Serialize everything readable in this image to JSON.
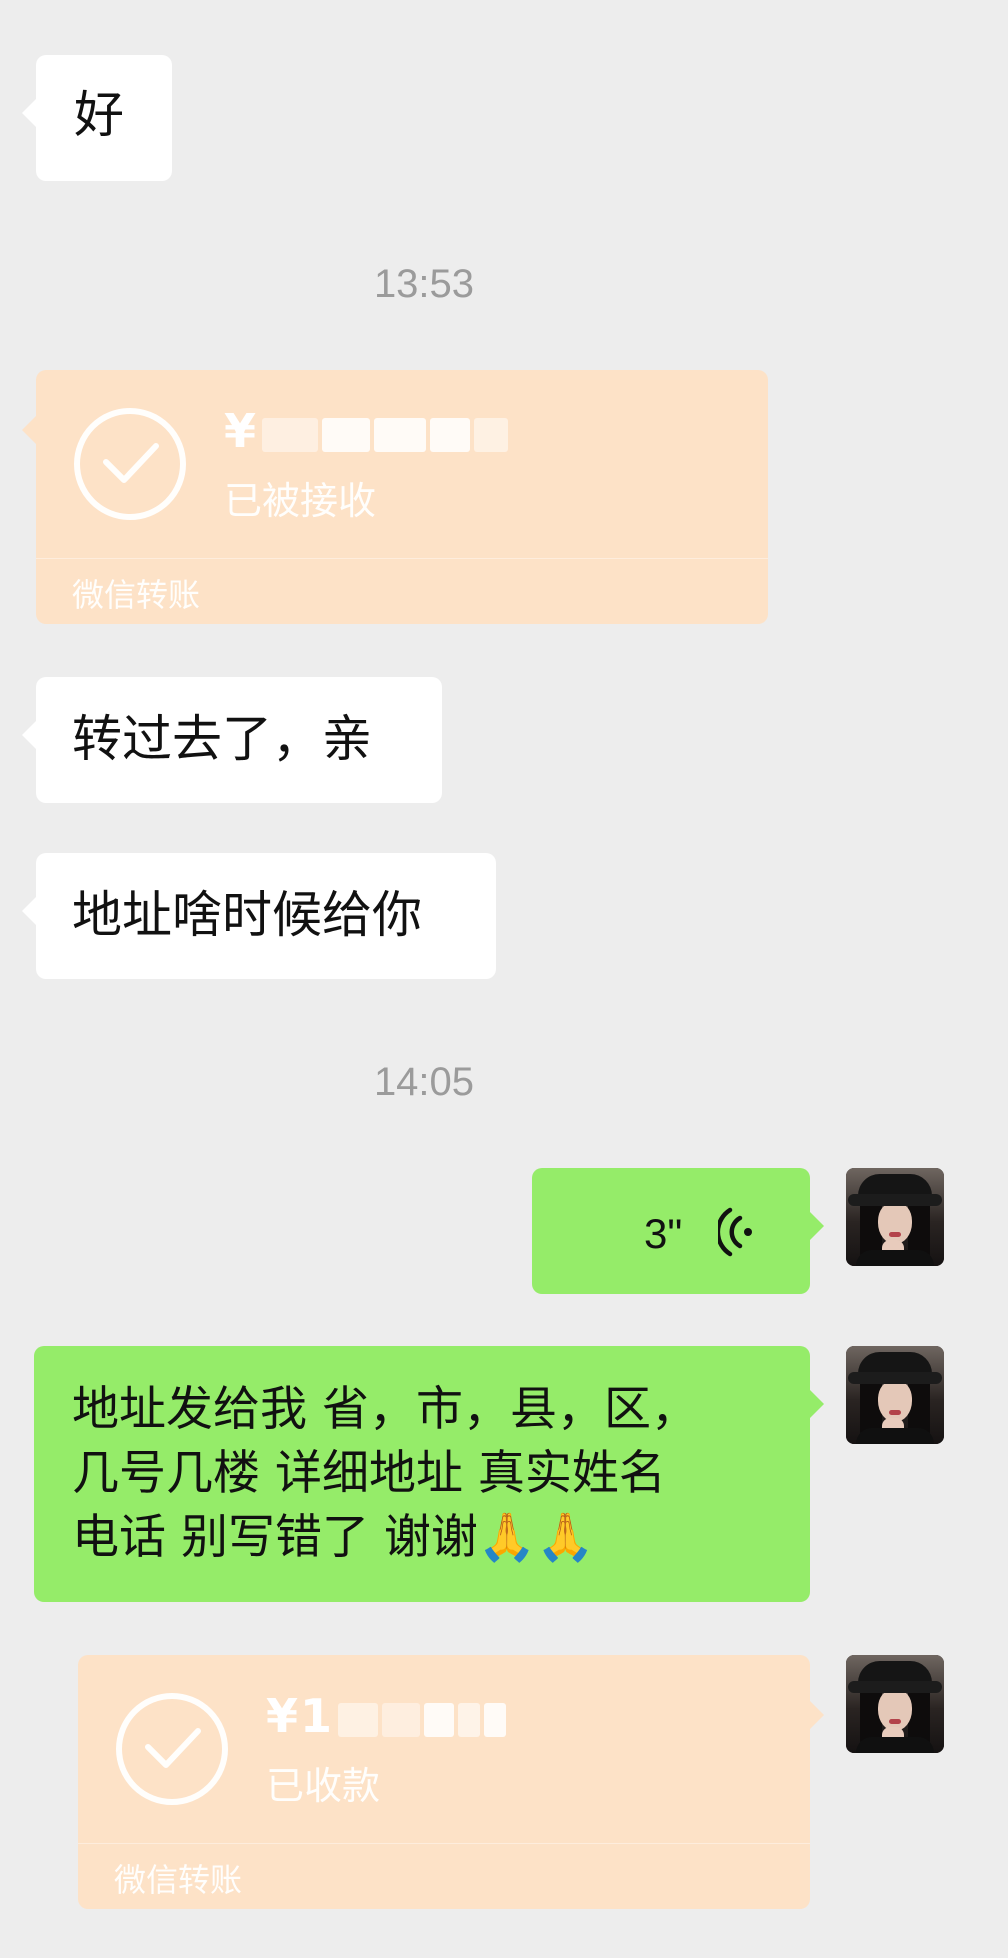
{
  "messages": {
    "m1": {
      "text": "好"
    },
    "t1": {
      "time": "13:53"
    },
    "transfer1": {
      "amount_visible": "¥",
      "status": "已被接收",
      "footer": "微信转账"
    },
    "m2": {
      "text": "转过去了，亲"
    },
    "m3": {
      "text": "地址啥时候给你"
    },
    "t2": {
      "time": "14:05"
    },
    "voice": {
      "duration": "3\"",
      "icon": "voice-waves-icon"
    },
    "m4": {
      "line1": "地址发给我 省，市，县，区，",
      "line2": "几号几楼 详细地址 真实姓名",
      "line3": "电话 别写错了 谢谢🙏🙏"
    },
    "transfer2": {
      "amount_visible": "¥1",
      "status": "已收款",
      "footer": "微信转账"
    }
  },
  "colors": {
    "background": "#ededed",
    "incoming_bubble": "#ffffff",
    "outgoing_bubble": "#95ec69",
    "transfer_card": "#fde2c7",
    "timestamp": "#9b9b9b"
  }
}
